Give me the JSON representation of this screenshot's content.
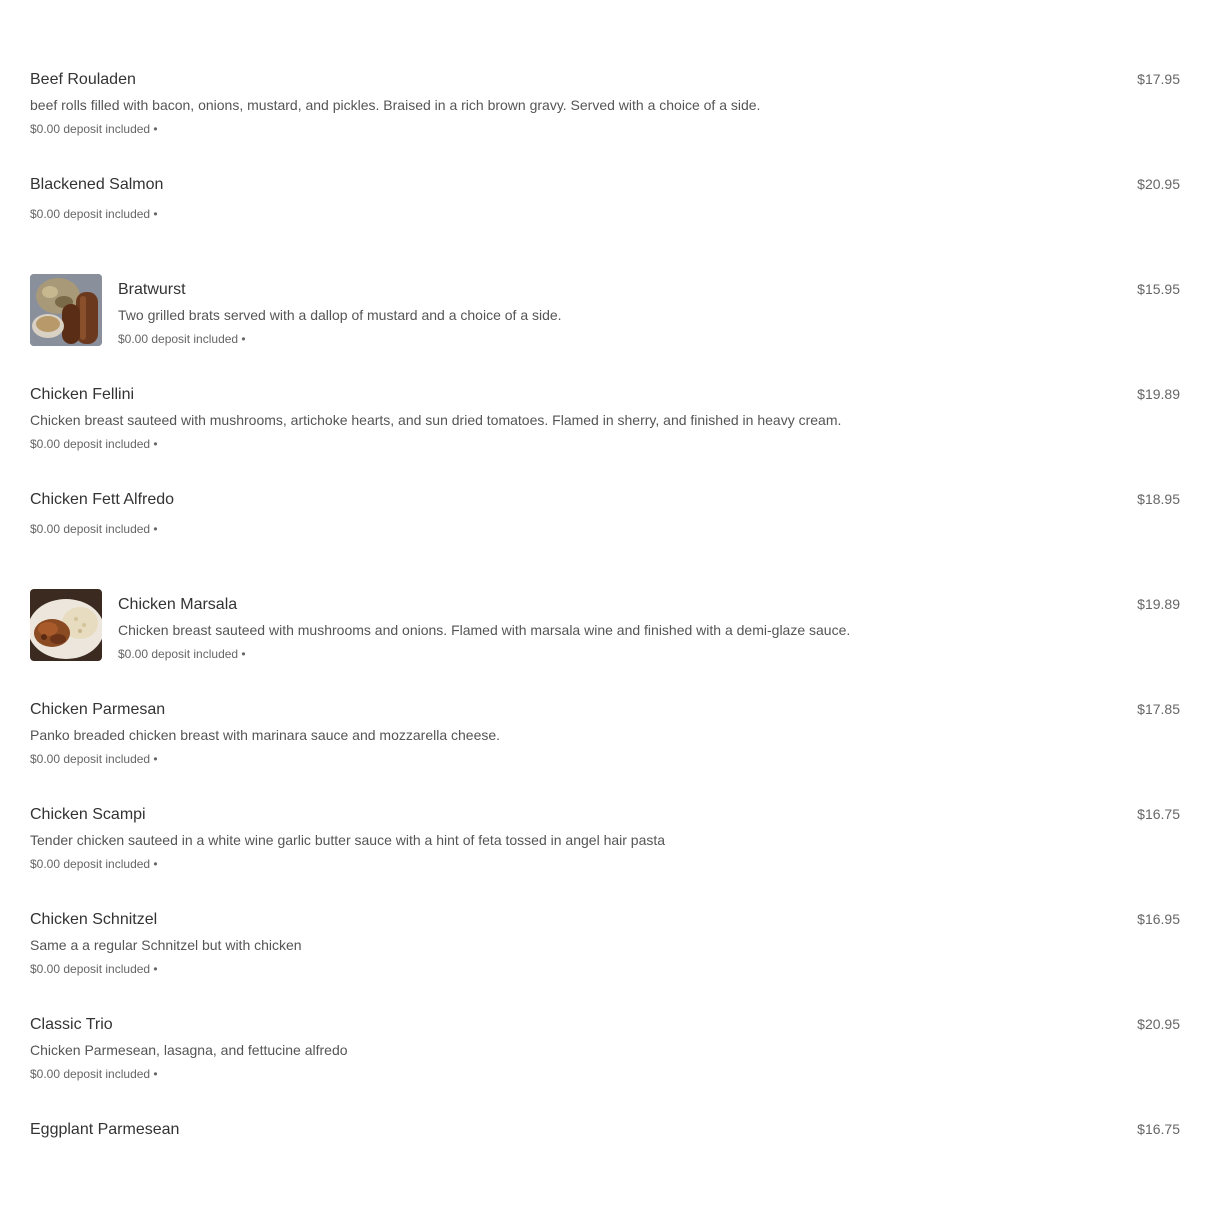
{
  "menu": {
    "items": [
      {
        "name": "Beef Rouladen",
        "description": "beef rolls filled with bacon, onions, mustard, and pickles. Braised in a rich brown gravy. Served with a choice of a side.",
        "meta": "$0.00 deposit included •",
        "price": "$17.95"
      },
      {
        "name": "Blackened Salmon",
        "description": "",
        "meta": "$0.00 deposit included •",
        "price": "$20.95"
      },
      {
        "name": "Bratwurst",
        "description": "Two grilled brats served with a dallop of mustard and a choice of a side.",
        "meta": "$0.00 deposit included •",
        "price": "$15.95",
        "image_icon": "bratwurst-photo"
      },
      {
        "name": "Chicken Fellini",
        "description": "Chicken breast sauteed with mushrooms, artichoke hearts, and sun dried tomatoes. Flamed in sherry, and finished in heavy cream.",
        "meta": "$0.00 deposit included •",
        "price": "$19.89"
      },
      {
        "name": "Chicken Fett Alfredo",
        "description": "",
        "meta": "$0.00 deposit included •",
        "price": "$18.95"
      },
      {
        "name": "Chicken Marsala",
        "description": "Chicken breast sauteed with mushrooms and onions. Flamed with marsala wine and finished with a demi-glaze sauce.",
        "meta": "$0.00 deposit included •",
        "price": "$19.89",
        "image_icon": "chicken-marsala-photo"
      },
      {
        "name": "Chicken Parmesan",
        "description": "Panko breaded chicken breast with marinara sauce and mozzarella cheese.",
        "meta": "$0.00 deposit included •",
        "price": "$17.85"
      },
      {
        "name": "Chicken Scampi",
        "description": "Tender chicken sauteed in a white wine garlic butter sauce with a hint of feta tossed in angel hair pasta",
        "meta": "$0.00 deposit included •",
        "price": "$16.75"
      },
      {
        "name": "Chicken Schnitzel",
        "description": "Same a a regular Schnitzel but with chicken",
        "meta": "$0.00 deposit included •",
        "price": "$16.95"
      },
      {
        "name": "Classic Trio",
        "description": "Chicken Parmesean, lasagna, and fettucine alfredo",
        "meta": "$0.00 deposit included •",
        "price": "$20.95"
      },
      {
        "name": "Eggplant Parmesean",
        "description": "",
        "meta": "",
        "price": "$16.75"
      }
    ]
  },
  "colors": {
    "text_primary": "#333333",
    "text_secondary": "#555555",
    "text_muted": "#666666",
    "background": "#ffffff"
  }
}
